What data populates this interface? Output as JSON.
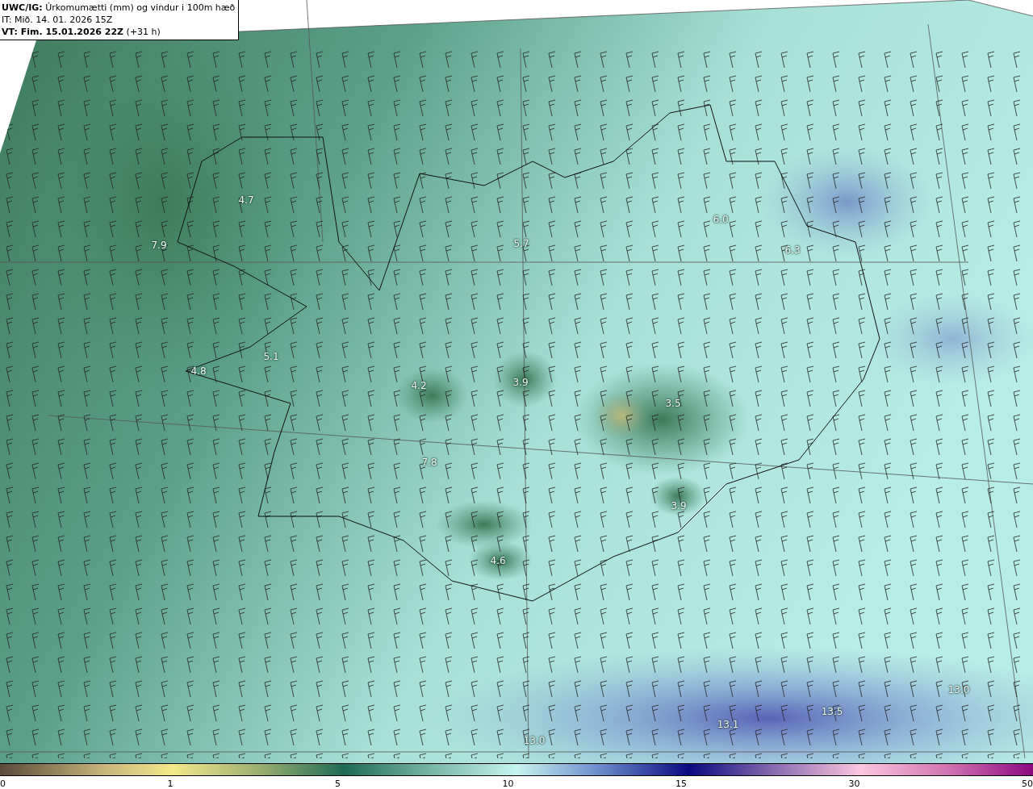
{
  "title": {
    "heading": "**UWC/IG:** Úrkomumætti (mm) og vindur i 100m hæð",
    "issue_time": "IT: Mið. 14. 01. 2026 15Z",
    "valid_time": "**VT: Fim. 15.01.2026 22Z** (+31 h)"
  },
  "map": {
    "value_labels": [
      "4.7",
      "7.9",
      "5.7",
      "6.0",
      "6.3",
      "5.1",
      "4.8",
      "4.2",
      "3.9",
      "3.5",
      "7.8",
      "3.9",
      "4.6",
      "13.0",
      "13.1",
      "13.5",
      "13.0"
    ]
  },
  "color_scale": {
    "tick_labels": [
      "0",
      "1",
      "5",
      "10",
      "15",
      "30",
      "50"
    ]
  }
}
